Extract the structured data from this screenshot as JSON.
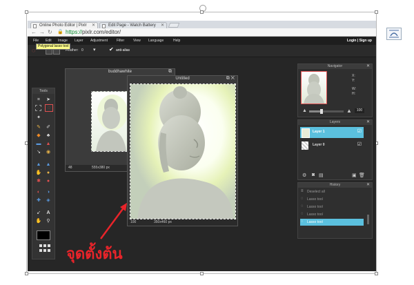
{
  "browser": {
    "tabs": [
      {
        "label": "Online Photo Editor | Pixlr"
      },
      {
        "label": "Edit Page - Watch Battery"
      }
    ],
    "url_scheme": "https://",
    "url_rest": "pixlr.com/editor/"
  },
  "menu": {
    "items": [
      "File",
      "Edit",
      "Image",
      "Layer",
      "Adjustment",
      "Filter",
      "View",
      "Language",
      "Help"
    ],
    "login": "Login | Sign up"
  },
  "options": {
    "feather_label": "Feather:",
    "feather_value": "0",
    "antialias_label": "anti-alias"
  },
  "tooltip": "Polygonal lasso tool",
  "tools": {
    "title": "Tools"
  },
  "doc_back": {
    "title": "buddhawhite",
    "zoom": "48",
    "size": "555x380 px"
  },
  "doc_front": {
    "title": "Untitled",
    "zoom": "100",
    "size": "350x460 px"
  },
  "navigator": {
    "title": "Navigator",
    "x_label": "X:",
    "y_label": "Y:",
    "w_label": "W:",
    "h_label": "H:",
    "zoom": "100"
  },
  "layers": {
    "title": "Layers",
    "items": [
      {
        "label": "Layer 1"
      },
      {
        "label": "Layer 0"
      }
    ]
  },
  "history": {
    "title": "History",
    "items": [
      "Deselect all",
      "Lasso tool",
      "Lasso tool",
      "Lasso tool",
      "Lasso tool"
    ]
  },
  "annotation": "จุดตั้งต้น",
  "colors": {
    "accent": "#5bc0de",
    "annotation": "#e8242a",
    "app_bg": "#262626"
  }
}
